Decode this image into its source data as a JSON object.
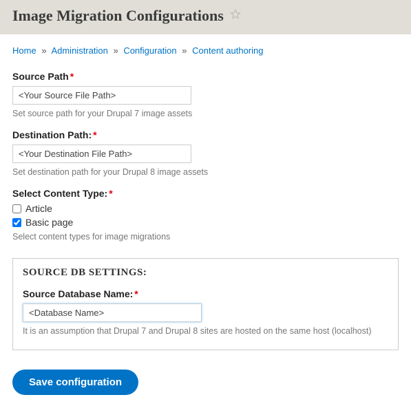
{
  "header": {
    "title": "Image Migration Configurations"
  },
  "breadcrumb": {
    "home": "Home",
    "admin": "Administration",
    "config": "Configuration",
    "content_auth": "Content authoring",
    "sep": "»"
  },
  "form": {
    "source_path": {
      "label": "Source Path",
      "value": "<Your Source File Path>",
      "description": "Set source path for your Drupal 7 image assets"
    },
    "dest_path": {
      "label": "Destination Path:",
      "value": "<Your Destination File Path>",
      "description": "Set destination path for your Drupal 8 image assets"
    },
    "content_type": {
      "label": "Select Content Type:",
      "options": {
        "article": "Article",
        "basic_page": "Basic page"
      },
      "description": "Select content types for image migrations"
    },
    "db": {
      "legend": "SOURCE DB SETTINGS:",
      "name_label": "Source Database Name:",
      "name_value": "<Database Name>",
      "description": "It is an assumption that Drupal 7 and Drupal 8 sites are hosted on the same host (localhost)"
    },
    "submit": "Save configuration"
  }
}
